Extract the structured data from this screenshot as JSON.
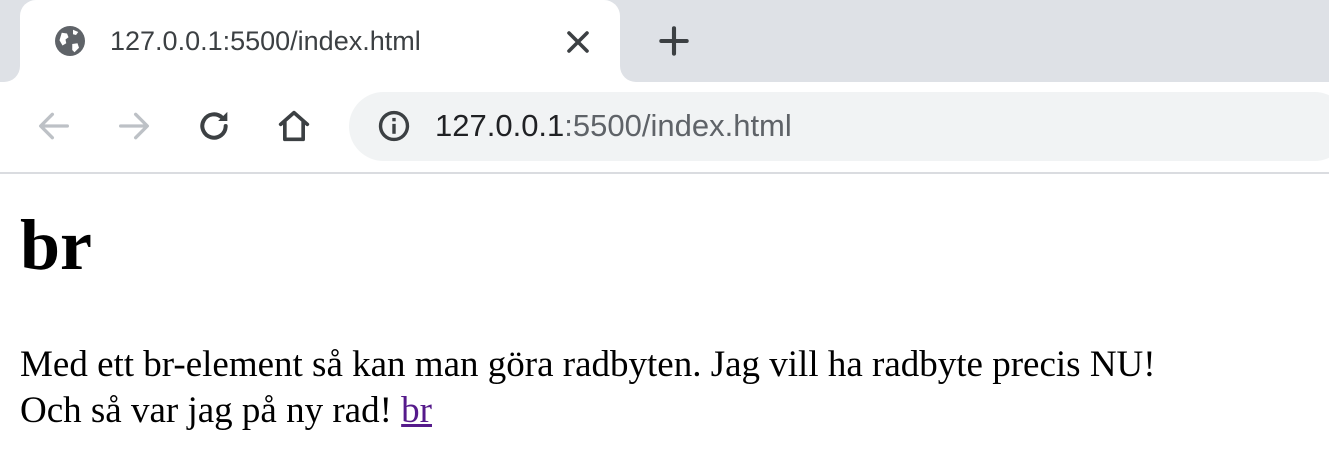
{
  "browser": {
    "tab": {
      "title": "127.0.0.1:5500/index.html",
      "favicon_icon": "globe-icon",
      "close_icon": "close-icon"
    },
    "new_tab_icon": "plus-icon",
    "nav": {
      "back_icon": "arrow-left-icon",
      "forward_icon": "arrow-right-icon",
      "reload_icon": "reload-icon",
      "home_icon": "home-icon"
    },
    "omnibox": {
      "security_icon": "info-icon",
      "url_host": "127.0.0.1",
      "url_rest": ":5500/index.html"
    }
  },
  "page": {
    "heading": "br",
    "line1": "Med ett br-element så kan man göra radbyten. Jag vill ha radbyte precis NU!",
    "line2": "Och så var jag på ny rad! ",
    "link_text": "br"
  },
  "colors": {
    "tabstrip_bg": "#dee1e6",
    "omnibox_bg": "#f1f3f4",
    "visited_link": "#551a8b"
  }
}
